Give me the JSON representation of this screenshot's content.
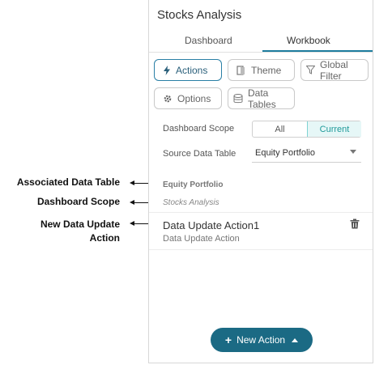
{
  "panel": {
    "title": "Stocks Analysis",
    "tabs": [
      {
        "label": "Dashboard",
        "active": false
      },
      {
        "label": "Workbook",
        "active": true
      }
    ],
    "buttons": {
      "actions": "Actions",
      "theme": "Theme",
      "global_filter": "Global Filter",
      "options": "Options",
      "data_tables": "Data Tables"
    },
    "dashboard_scope": {
      "label": "Dashboard Scope",
      "options": [
        "All",
        "Current"
      ],
      "selected": "Current"
    },
    "source_data_table": {
      "label": "Source Data Table",
      "value": "Equity Portfolio"
    },
    "section": {
      "data_table": "Equity Portfolio",
      "scope": "Stocks Analysis"
    },
    "action_item": {
      "name": "Data Update Action1",
      "type": "Data Update Action"
    },
    "new_action_label": "New Action"
  },
  "callouts": {
    "associated_data_table": "Associated Data Table",
    "dashboard_scope": "Dashboard Scope",
    "new_data_update_line1": "New Data Update",
    "new_data_update_line2": "Action"
  },
  "colors": {
    "accent": "#1e7d9e",
    "primary_button": "#1b6a84",
    "current_bg": "#e6f7f7",
    "current_text": "#1f9a9a"
  }
}
